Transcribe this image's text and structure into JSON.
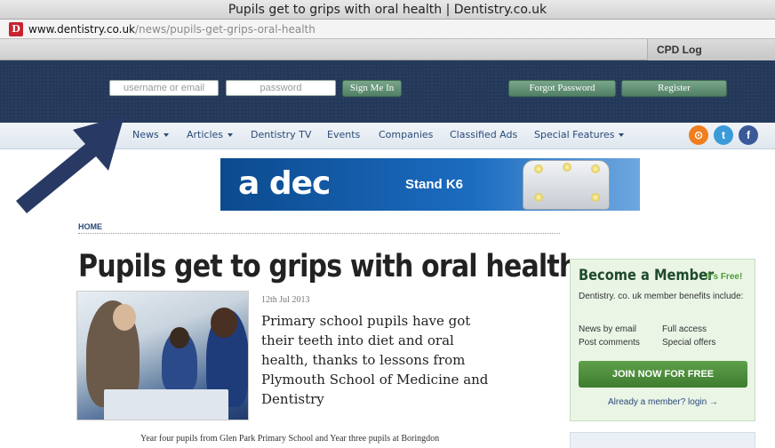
{
  "window": {
    "title": "Pupils get to grips with oral health | Dentistry.co.uk",
    "favicon_letter": "D",
    "url_host": "www.dentistry.co.uk",
    "url_path": "/news/pupils-get-grips-oral-health"
  },
  "bookmarks": {
    "cpd_log": "CPD Log"
  },
  "login": {
    "username_placeholder": "username or email",
    "password_placeholder": "password",
    "sign_in": "Sign Me In",
    "forgot": "Forgot Password",
    "register": "Register"
  },
  "nav": {
    "items": [
      {
        "label": "News"
      },
      {
        "label": "Articles"
      },
      {
        "label": "Dentistry TV"
      },
      {
        "label": "Events"
      },
      {
        "label": "Companies"
      },
      {
        "label": "Classified Ads"
      },
      {
        "label": "Special Features"
      }
    ],
    "social": [
      {
        "name": "rss-icon",
        "glyph": "⊙",
        "color": "#f07d1e"
      },
      {
        "name": "twitter-icon",
        "glyph": "t",
        "color": "#3a9bd8"
      },
      {
        "name": "facebook-icon",
        "glyph": "f",
        "color": "#3b5998"
      }
    ]
  },
  "banner": {
    "brand": "a dec",
    "stand": "Stand K6"
  },
  "breadcrumb": {
    "home": "HOME"
  },
  "article": {
    "headline": "Pupils get to grips with oral health",
    "date": "12th Jul 2013",
    "standfirst": "Primary school pupils have got their teeth into diet and oral health, thanks to lessons from Plymouth School of Medicine and Dentistry",
    "body_start": "Year four pupils from Glen Park Primary School and Year three pupils at Boringdon"
  },
  "member_box": {
    "title": "Become a Member",
    "free": "It's Free!",
    "text": "Dentistry. co. uk member benefits include:",
    "benefits": [
      "News by email",
      "Full access",
      "Post comments",
      "Special offers"
    ],
    "join": "JOIN NOW FOR FREE",
    "login": "Already a member? login →"
  },
  "colors": {
    "header_band": "#24395a",
    "nav_text": "#2a4a78",
    "join_green": "#4f8f3c",
    "arrow": "#283a64"
  }
}
